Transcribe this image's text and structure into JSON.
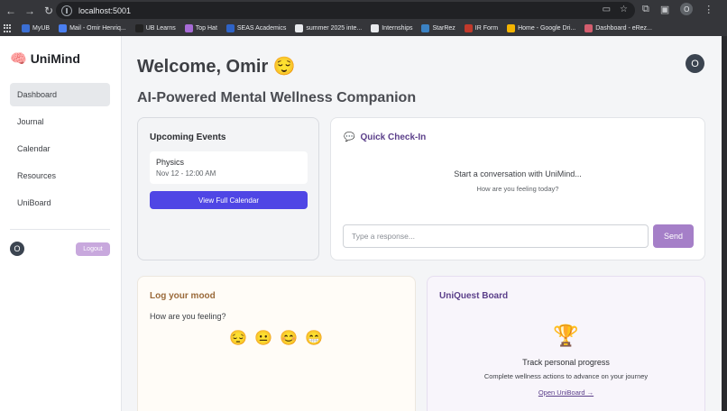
{
  "browser": {
    "url": "localhost:5001",
    "profile_initial": "O",
    "bookmarks": [
      {
        "label": "MyUB",
        "color": "#3b6fd4"
      },
      {
        "label": "Mail - Omir Henriq...",
        "color": "#4a7ff0"
      },
      {
        "label": "UB Learns",
        "color": "#222222"
      },
      {
        "label": "Top Hat",
        "color": "#a76bd6"
      },
      {
        "label": "SEAS Academics",
        "color": "#2e63c7"
      },
      {
        "label": "summer 2025 inte...",
        "color": "#e8eaed"
      },
      {
        "label": "Internships",
        "color": "#e8eaed"
      },
      {
        "label": "StarRez",
        "color": "#3b82c4"
      },
      {
        "label": "IR Form",
        "color": "#c0392b"
      },
      {
        "label": "Home - Google Dri...",
        "color": "#f4b400"
      },
      {
        "label": "Dashboard - eRez...",
        "color": "#d35d6e"
      }
    ]
  },
  "sidebar": {
    "brand": "UniMind",
    "nav": [
      {
        "label": "Dashboard",
        "active": true
      },
      {
        "label": "Journal",
        "active": false
      },
      {
        "label": "Calendar",
        "active": false
      },
      {
        "label": "Resources",
        "active": false
      },
      {
        "label": "UniBoard",
        "active": false
      }
    ],
    "avatar_initial": "O",
    "logout_label": "Logout"
  },
  "header": {
    "welcome": "Welcome, Omir 😌",
    "subtitle": "AI-Powered Mental Wellness Companion",
    "avatar_initial": "O"
  },
  "events": {
    "title": "Upcoming Events",
    "items": [
      {
        "name": "Physics",
        "date": "Nov 12 - 12:00 AM"
      }
    ],
    "button_label": "View Full Calendar"
  },
  "checkin": {
    "title": "Quick Check-In",
    "prompt": "Start a conversation with UniMind...",
    "sub": "How are you feeling today?",
    "input_placeholder": "Type a response...",
    "input_value": "",
    "send_label": "Send"
  },
  "mood": {
    "title": "Log your mood",
    "question": "How are you feeling?",
    "emojis": [
      "😔",
      "😐",
      "😊",
      "😁"
    ]
  },
  "board": {
    "title": "UniQuest Board",
    "track": "Track personal progress",
    "desc": "Complete wellness actions to advance on your journey",
    "link": "Open UniBoard →"
  }
}
